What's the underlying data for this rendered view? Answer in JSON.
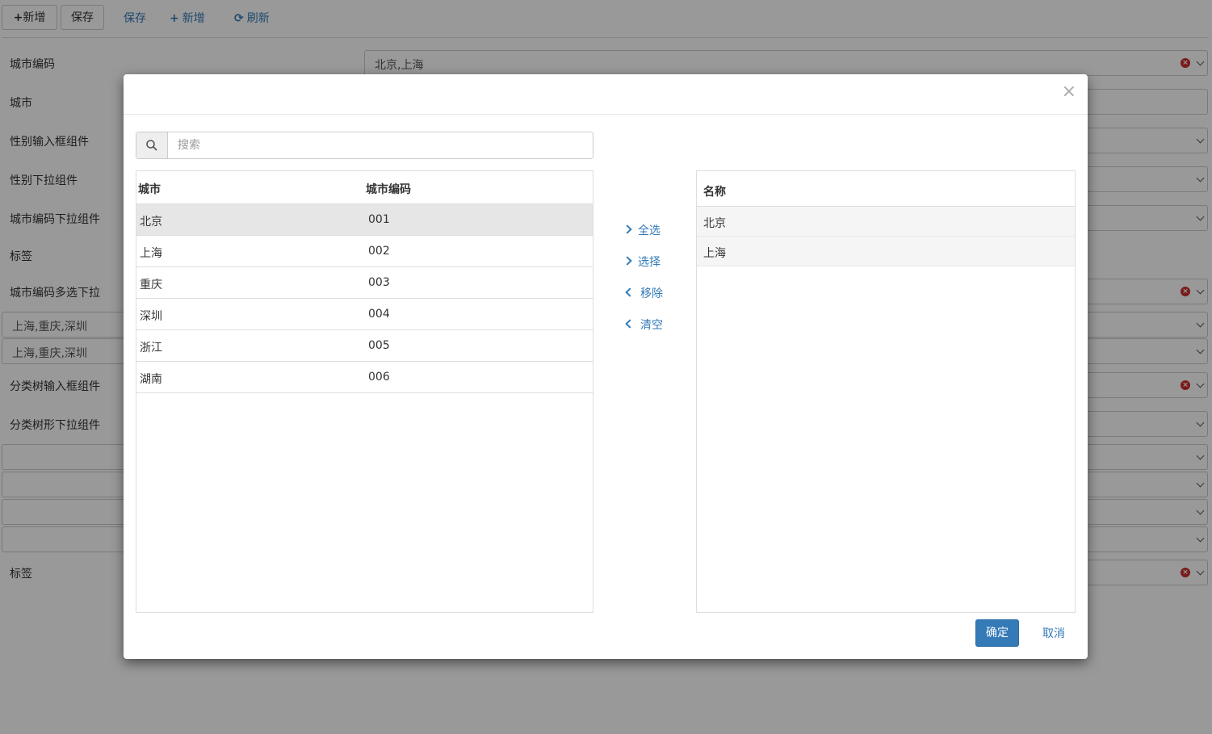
{
  "toolbar": {
    "add_btn": "新增",
    "save_btn": "保存",
    "save_link": "保存",
    "add_link": "新增",
    "refresh_link": "刷新"
  },
  "form": {
    "labels": {
      "city_code": "城市编码",
      "city": "城市",
      "gender_input": "性别输入框组件",
      "gender_select": "性别下拉组件",
      "city_code_select": "城市编码下拉组件",
      "tag": "标签",
      "city_code_multi": "城市编码多选下拉",
      "tree_input": "分类树输入框组件",
      "tree_select": "分类树形下拉组件",
      "tag2": "标签"
    },
    "values": {
      "city_code": "北京,上海",
      "multi_1": "上海,重庆,深圳",
      "multi_2": "上海,重庆,深圳"
    }
  },
  "modal": {
    "close": "×",
    "search_placeholder": "搜索",
    "left_table": {
      "columns": [
        "城市",
        "城市编码"
      ],
      "rows": [
        {
          "city": "北京",
          "code": "001"
        },
        {
          "city": "上海",
          "code": "002"
        },
        {
          "city": "重庆",
          "code": "003"
        },
        {
          "city": "深圳",
          "code": "004"
        },
        {
          "city": "浙江",
          "code": "005"
        },
        {
          "city": "湖南",
          "code": "006"
        }
      ]
    },
    "actions": {
      "select_all": "全选",
      "select": "选择",
      "remove": "移除",
      "clear": "清空"
    },
    "right_table": {
      "column": "名称",
      "rows": [
        "北京",
        "上海"
      ]
    },
    "confirm": "确定",
    "cancel": "取消"
  },
  "colors": {
    "primary": "#337ab7",
    "danger": "#c9302c",
    "selected_row": "#e6e6e6"
  }
}
